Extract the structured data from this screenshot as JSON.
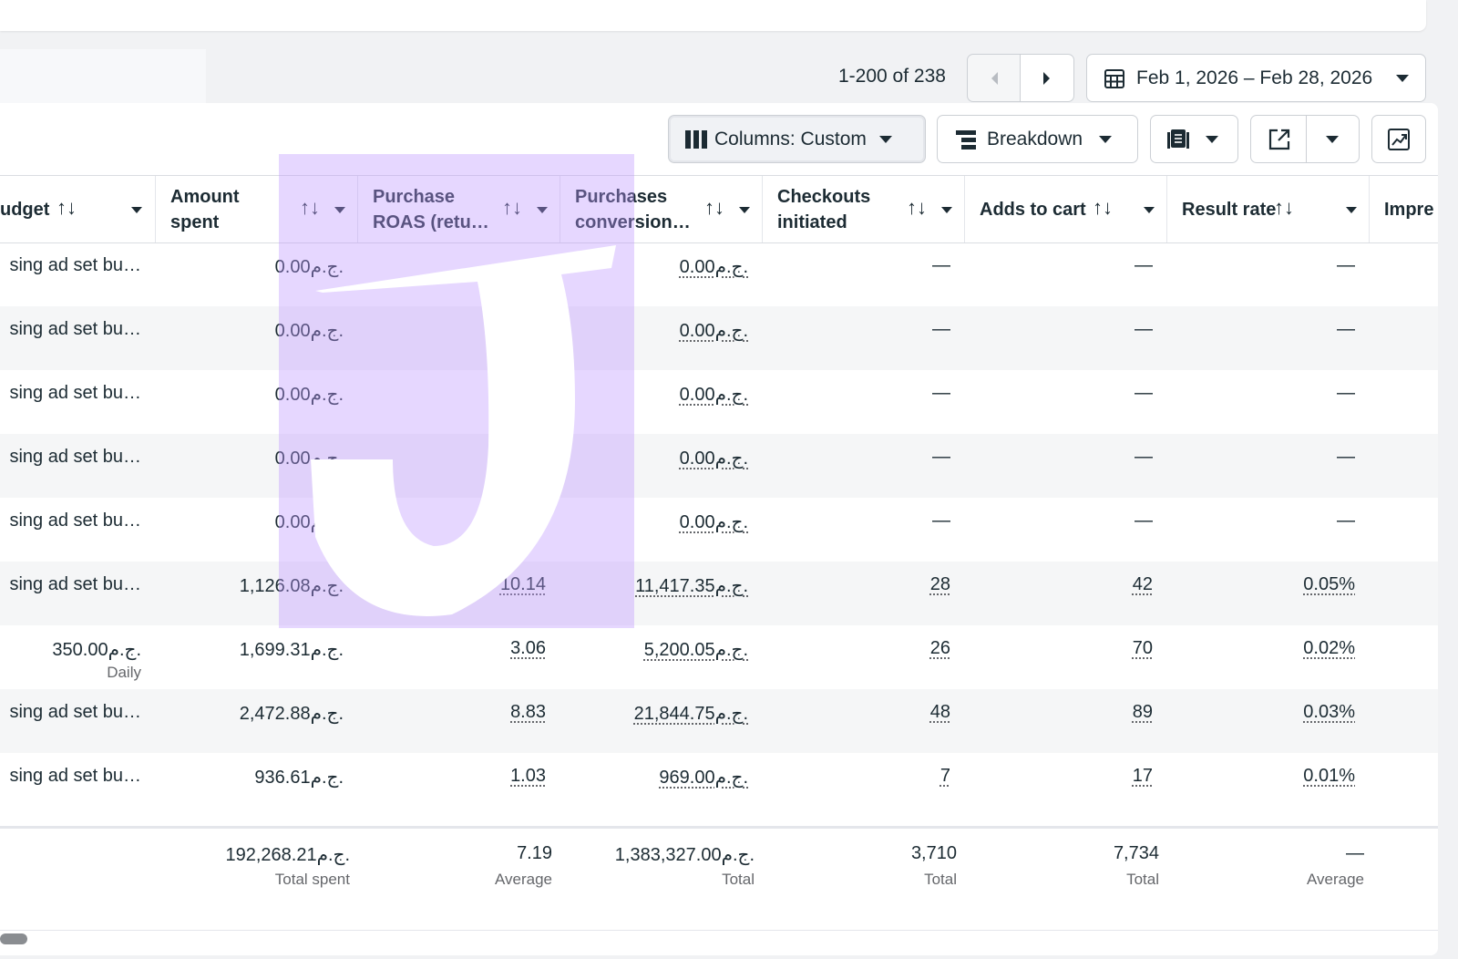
{
  "toolbar": {
    "pagination": "1-200 of 238",
    "date_range": "Feb 1, 2026 – Feb 28, 2026",
    "columns_label": "Columns: Custom",
    "breakdown_label": "Breakdown"
  },
  "columns": [
    {
      "key": "budget",
      "label": "udget"
    },
    {
      "key": "amount_spent",
      "label": "Amount spent"
    },
    {
      "key": "roas",
      "label": "Purchase ROAS (retu…"
    },
    {
      "key": "conv_value",
      "label": "Purchases conversion…"
    },
    {
      "key": "checkouts",
      "label": "Checkouts initiated"
    },
    {
      "key": "adds_to_cart",
      "label": "Adds to cart"
    },
    {
      "key": "result_rate",
      "label": "Result rate"
    },
    {
      "key": "impressions",
      "label": "Impre"
    }
  ],
  "rows": [
    {
      "budget": "sing ad set bu…",
      "budget_sub": "",
      "amount_spent": "0.00ج.م.",
      "roas": "—",
      "conv_value": "0.00ج.م.",
      "checkouts": "—",
      "adds_to_cart": "—",
      "result_rate": "—"
    },
    {
      "budget": "sing ad set bu…",
      "budget_sub": "",
      "amount_spent": "0.00ج.م.",
      "roas": "—",
      "conv_value": "0.00ج.م.",
      "checkouts": "—",
      "adds_to_cart": "—",
      "result_rate": "—"
    },
    {
      "budget": "sing ad set bu…",
      "budget_sub": "",
      "amount_spent": "0.00ج.م.",
      "roas": "—",
      "conv_value": "0.00ج.م.",
      "checkouts": "—",
      "adds_to_cart": "—",
      "result_rate": "—"
    },
    {
      "budget": "sing ad set bu…",
      "budget_sub": "",
      "amount_spent": "0.00ج.م.",
      "roas": "—",
      "conv_value": "0.00ج.م.",
      "checkouts": "—",
      "adds_to_cart": "—",
      "result_rate": "—"
    },
    {
      "budget": "sing ad set bu…",
      "budget_sub": "",
      "amount_spent": "0.00ج.م.",
      "roas": "—",
      "conv_value": "0.00ج.م.",
      "checkouts": "—",
      "adds_to_cart": "—",
      "result_rate": "—"
    },
    {
      "budget": "sing ad set bu…",
      "budget_sub": "",
      "amount_spent": "1,126.08ج.م.",
      "roas": "10.14",
      "conv_value": "11,417.35ج.م.",
      "checkouts": "28",
      "adds_to_cart": "42",
      "result_rate": "0.05%"
    },
    {
      "budget": "350.00ج.م.",
      "budget_sub": "Daily",
      "amount_spent": "1,699.31ج.م.",
      "roas": "3.06",
      "conv_value": "5,200.05ج.م.",
      "checkouts": "26",
      "adds_to_cart": "70",
      "result_rate": "0.02%"
    },
    {
      "budget": "sing ad set bu…",
      "budget_sub": "",
      "amount_spent": "2,472.88ج.م.",
      "roas": "8.83",
      "conv_value": "21,844.75ج.م.",
      "checkouts": "48",
      "adds_to_cart": "89",
      "result_rate": "0.03%"
    },
    {
      "budget": "sing ad set bu…",
      "budget_sub": "",
      "amount_spent": "936.61ج.م.",
      "roas": "1.03",
      "conv_value": "969.00ج.م.",
      "checkouts": "7",
      "adds_to_cart": "17",
      "result_rate": "0.01%"
    }
  ],
  "totals": {
    "amount_spent": "192,268.21ج.م.",
    "amount_spent_sub": "Total spent",
    "roas": "7.19",
    "roas_sub": "Average",
    "conv_value": "1,383,327.00ج.م.",
    "conv_value_sub": "Total",
    "checkouts": "3,710",
    "checkouts_sub": "Total",
    "adds_to_cart": "7,734",
    "adds_to_cart_sub": "Total",
    "result_rate": "—",
    "result_rate_sub": "Average"
  },
  "icons": {
    "sort": "↑↓",
    "calendar": "calendar-icon",
    "columns": "columns-icon",
    "breakdown": "breakdown-icon",
    "reports": "reports-icon",
    "export": "export-icon",
    "chart": "chart-icon"
  },
  "colors": {
    "text": "#1c2b33",
    "muted": "#65676b",
    "border": "#ccd0d5",
    "row_alt": "#f5f6f7",
    "watermark": "#be96ff"
  }
}
